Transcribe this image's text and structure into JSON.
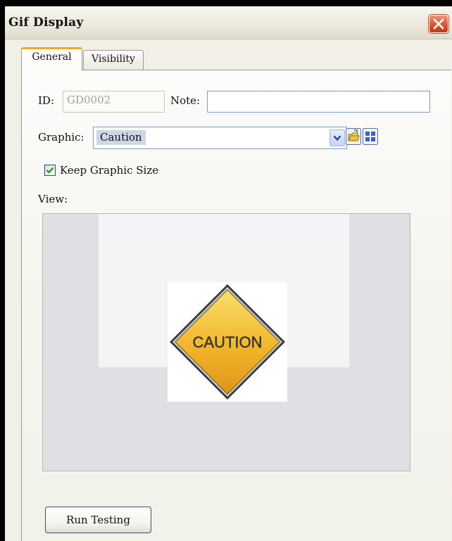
{
  "window": {
    "title": "Gif Display"
  },
  "tabs": [
    {
      "label": "General",
      "active": true
    },
    {
      "label": "Visibility",
      "active": false
    }
  ],
  "form": {
    "id_label": "ID:",
    "id_value": "GD0002",
    "note_label": "Note:",
    "note_value": "",
    "graphic_label": "Graphic:",
    "graphic_value": "Caution",
    "keep_size_label": "Keep Graphic Size",
    "keep_size_checked": true,
    "view_label": "View:"
  },
  "preview": {
    "sign_text": "CAUTION",
    "sign_color": "#f2b62a"
  },
  "buttons": {
    "run_testing": "Run Testing"
  },
  "icons": {
    "close": "close-icon",
    "dropdown": "chevron-down-icon",
    "open_folder": "open-folder-icon",
    "library": "grid-library-icon",
    "check": "checkmark-icon"
  },
  "colors": {
    "accent_tab": "#f4a722",
    "close_button": "#d9603f"
  }
}
